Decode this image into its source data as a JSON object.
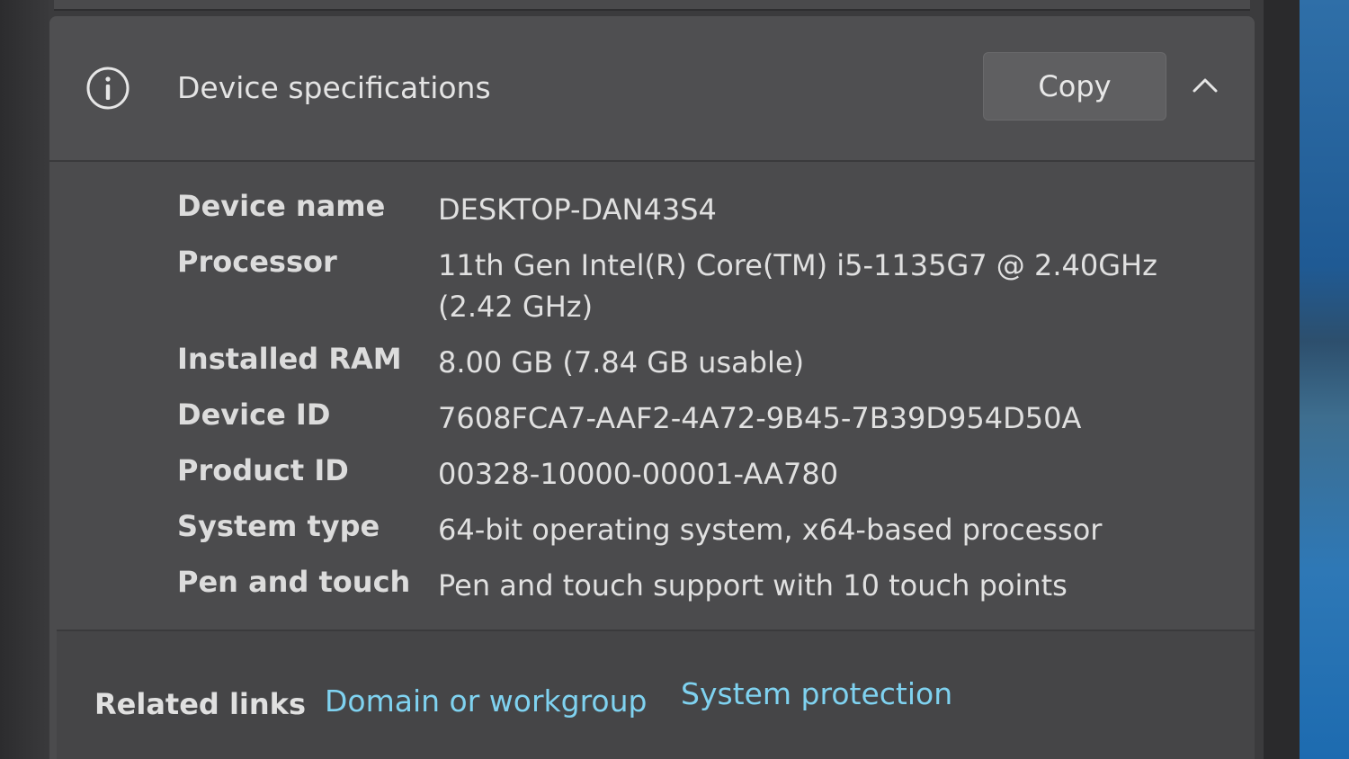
{
  "header": {
    "title": "Device specifications",
    "copy_label": "Copy",
    "info_icon": "info-icon",
    "collapse_icon": "chevron-up-icon"
  },
  "specs": [
    {
      "label": "Device name",
      "value": "DESKTOP-DAN43S4"
    },
    {
      "label": "Processor",
      "value": "11th Gen Intel(R) Core(TM) i5-1135G7 @ 2.40GHz (2.42 GHz)"
    },
    {
      "label": "Installed RAM",
      "value": "8.00 GB (7.84 GB usable)"
    },
    {
      "label": "Device ID",
      "value": "7608FCA7-AAF2-4A72-9B45-7B39D954D50A"
    },
    {
      "label": "Product ID",
      "value": "00328-10000-00001-AA780"
    },
    {
      "label": "System type",
      "value": "64-bit operating system, x64-based processor"
    },
    {
      "label": "Pen and touch",
      "value": "Pen and touch support with 10 touch points"
    }
  ],
  "related": {
    "label": "Related links",
    "links": [
      "Domain or workgroup",
      "System protection"
    ]
  },
  "colors": {
    "link": "#7fd2f0",
    "panel": "#4b4b4d",
    "text": "#e0e0e0"
  }
}
